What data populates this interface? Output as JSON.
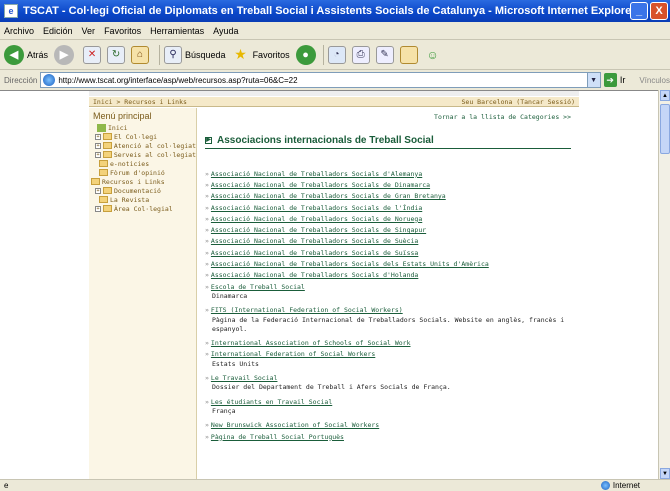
{
  "window": {
    "title": "TSCAT - Col·legi Oficial de Diplomats en Treball Social i Assistents Socials de Catalunya - Microsoft Internet Explorer",
    "minimize": "_",
    "close": "X"
  },
  "menubar": [
    "Archivo",
    "Edición",
    "Ver",
    "Favoritos",
    "Herramientas",
    "Ayuda"
  ],
  "toolbar": {
    "back": "Atrás",
    "search": "Búsqueda",
    "favorites": "Favoritos"
  },
  "address": {
    "label": "Dirección",
    "url": "http://www.tscat.org/interface/asp/web/recursos.asp?ruta=06&C=22",
    "go": "Ir",
    "links": "Vínculos"
  },
  "page": {
    "breadcrumb": "Inici > Recursos i Links",
    "session": "Seu Barcelona  (Tancar Sessió)",
    "menu_title": "Menú principal",
    "menu": [
      {
        "label": "Inici",
        "type": "home"
      },
      {
        "label": "El Col·legi",
        "type": "plus"
      },
      {
        "label": "Atenció al col·legiat",
        "type": "plus"
      },
      {
        "label": "Serveis al col·legiat",
        "type": "plus"
      },
      {
        "label": "e-noticies",
        "type": "folder"
      },
      {
        "label": "Fòrum d'opinió",
        "type": "folder"
      },
      {
        "label": "Recursos i Links",
        "type": "folder-top"
      },
      {
        "label": "Documentació",
        "type": "plus"
      },
      {
        "label": "La Revista",
        "type": "folder"
      },
      {
        "label": "Àrea Col·legial",
        "type": "plus"
      }
    ],
    "back_link": "Tornar a la llista de Categories >>",
    "heading": "Associacions internacionals de Treball Social",
    "links": [
      {
        "label": "Associació Nacional de Treballadors Socials d'Alemanya"
      },
      {
        "label": "Associació Nacional de Treballadors Socials de Dinamarca"
      },
      {
        "label": "Associació Nacional de Treballadors Socials de Gran Bretanya"
      },
      {
        "label": "Associació Nacional de Treballadors Socials de l'Índia"
      },
      {
        "label": "Associació Nacional de Treballadors Socials de Noruega"
      },
      {
        "label": "Associació Nacional de Treballadors Socials de Singapur"
      },
      {
        "label": "Associació Nacional de Treballadors Socials de Suècia"
      },
      {
        "label": "Associació Nacional de Treballadors Socials de Suïssa"
      },
      {
        "label": "Associació Nacional de Treballadors Socials dels Estats Units d'Amèrica"
      },
      {
        "label": "Associació Nacional de Treballadors Socials d'Holanda"
      },
      {
        "label": "Escola de Treball Social",
        "desc": "Dinamarca"
      },
      {
        "label": "FITS (International Federation of Social Workers)",
        "desc": "Pàgina de la Federació Internacional de Treballadors Socials. Website en anglès, francès i espanyol."
      },
      {
        "label": "International Association of Schools of Social Work"
      },
      {
        "label": "International Federation of Social Workers",
        "desc": "Estats Units"
      },
      {
        "label": "Le Travail Social",
        "desc": "Dossier del Departament de Treball i Afers Socials de França."
      },
      {
        "label": "Les étudiants en Travail Social",
        "desc": "França"
      },
      {
        "label": "New Brunswick Association of Social Workers"
      },
      {
        "label": "Pàgina de Treball Social Portuguès"
      }
    ]
  },
  "status": {
    "zone": "Internet"
  }
}
